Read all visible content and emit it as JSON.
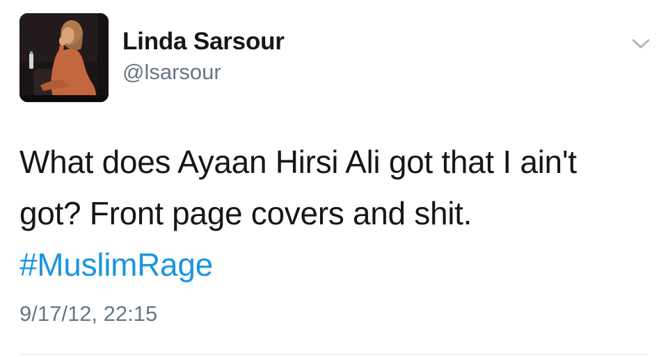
{
  "user": {
    "display_name": "Linda Sarsour",
    "handle": "@lsarsour",
    "avatar_icon": "profile-photo"
  },
  "tweet": {
    "line1": "What does Ayaan Hirsi Ali got that I ain't",
    "line2": "got? Front page covers and shit.",
    "hashtag": "#MuslimRage",
    "timestamp": "9/17/12, 22:15"
  },
  "menu": {
    "icon": "chevron-down-icon"
  },
  "colors": {
    "text": "#14171a",
    "secondary": "#657786",
    "link": "#1b95e0",
    "divider": "#e1e8ed"
  }
}
